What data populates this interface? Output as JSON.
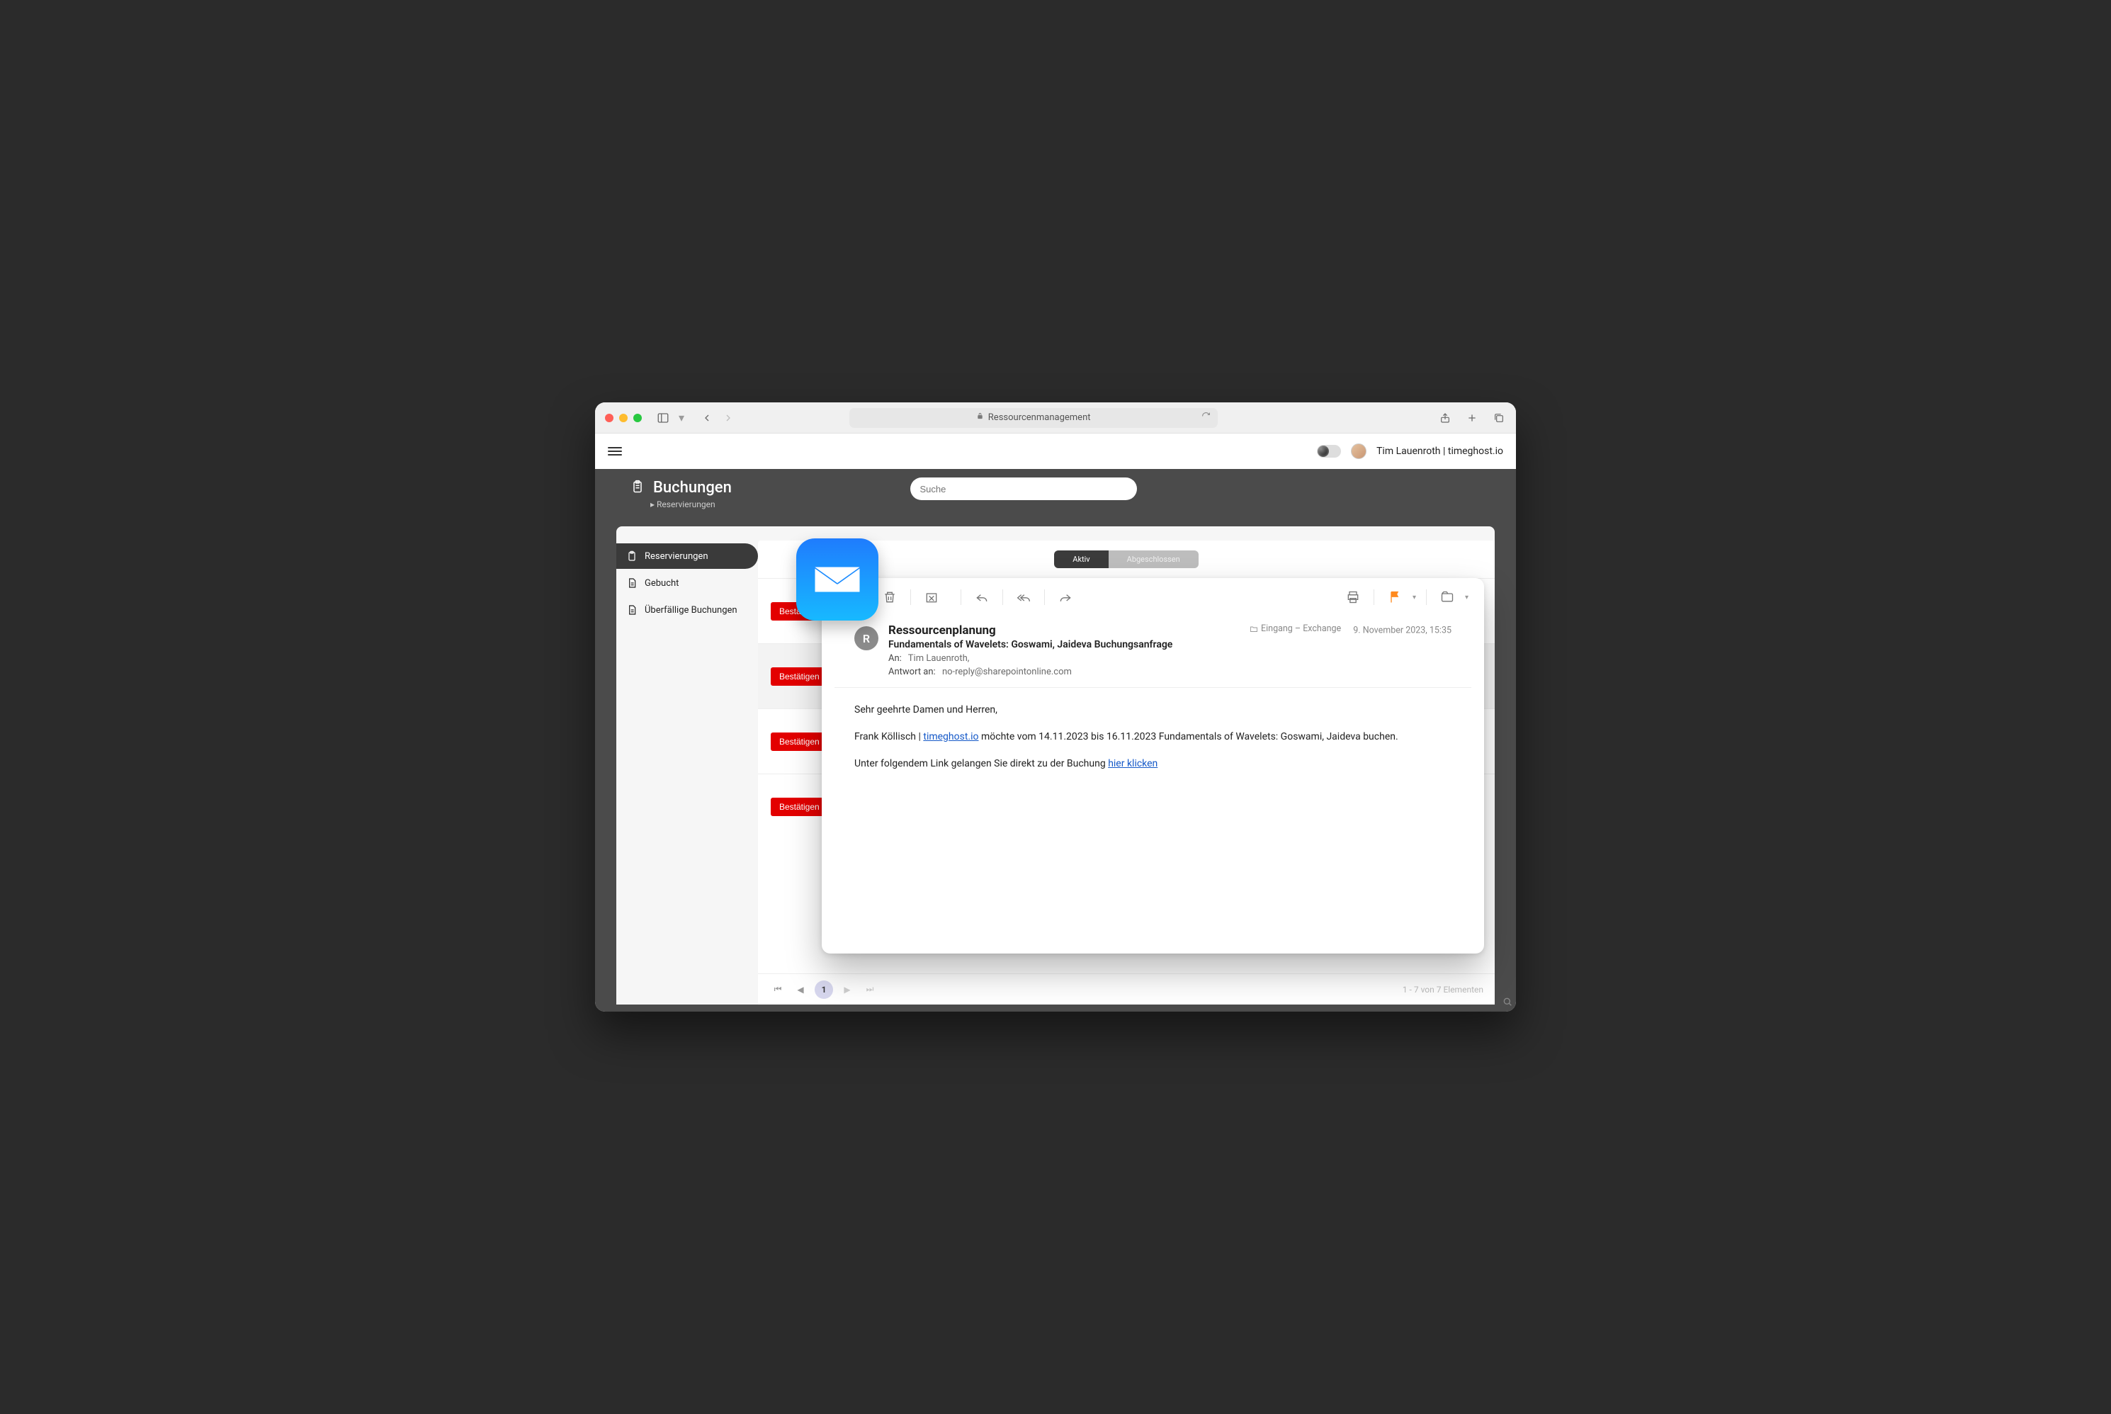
{
  "browser": {
    "address_title": "Ressourcenmanagement"
  },
  "app_header": {
    "user_label": "Tim Lauenroth | timeghost.io"
  },
  "sub_header": {
    "title": "Buchungen",
    "breadcrumb": "Reservierungen",
    "search_placeholder": "Suche"
  },
  "sidebar": {
    "items": [
      {
        "label": "Reservierungen"
      },
      {
        "label": "Gebucht"
      },
      {
        "label": "Überfällige Buchungen"
      }
    ]
  },
  "segment": {
    "active": "Aktiv",
    "inactive": "Abgeschlossen"
  },
  "row_button": "Bestätigen",
  "pager": {
    "current": "1",
    "summary": "1 - 7 von 7 Elementen"
  },
  "mail": {
    "sender_initial": "R",
    "sender": "Ressourcenplanung",
    "subject": "Fundamentals of Wavelets: Goswami, Jaideva Buchungsanfrage",
    "to_label": "An:",
    "to_value": "Tim Lauenroth,",
    "reply_label": "Antwort an:",
    "reply_value": "no-reply@sharepointonline.com",
    "folder": "Eingang – Exchange",
    "date": "9. November 2023, 15:35",
    "body": {
      "greeting": "Sehr geehrte Damen und Herren,",
      "line2_pre": "Frank Köllisch | ",
      "line2_link1": "timeghost.io",
      "line2_post": " möchte vom 14.11.2023 bis 16.11.2023 Fundamentals of Wavelets: Goswami, Jaideva buchen.",
      "line3_pre": "Unter folgendem Link gelangen Sie direkt zu der Buchung ",
      "line3_link": "hier klicken"
    }
  }
}
